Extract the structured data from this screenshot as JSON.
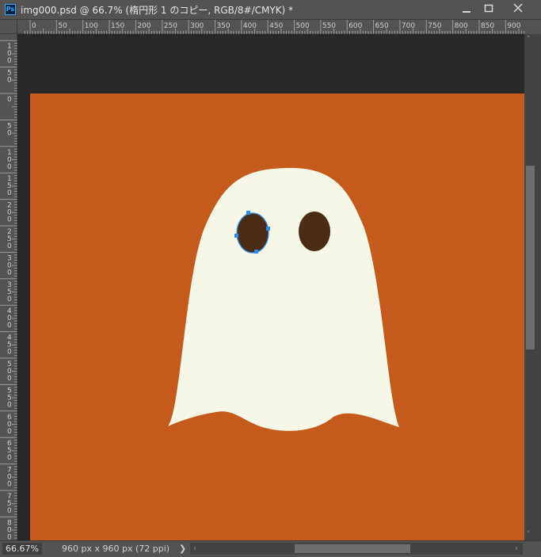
{
  "window": {
    "app_icon": "ps-app-icon",
    "app_icon_text": "Ps",
    "title": "img000.psd @ 66.7% (楕円形 1 のコピー, RGB/8#/CMYK) *",
    "controls": [
      "minimize-icon",
      "maximize-icon",
      "close-icon"
    ]
  },
  "rulers": {
    "horizontal_labels": [
      "0",
      "50",
      "100",
      "150",
      "200",
      "250",
      "300",
      "350",
      "400",
      "450",
      "500",
      "550",
      "600",
      "650",
      "700",
      "750",
      "800",
      "850",
      "900"
    ],
    "vertical_labels": [
      "100",
      "50",
      "0",
      "50",
      "100",
      "150",
      "200",
      "250",
      "300",
      "350",
      "400",
      "450",
      "500",
      "550",
      "600",
      "650",
      "700",
      "750",
      "800"
    ]
  },
  "canvas": {
    "background_color": "#c45b1d",
    "pasteboard_color": "#282828",
    "ghost_color": "#f7f7e7",
    "eye_color": "#4a2c14",
    "selection_color": "#2f8ce6",
    "selected_layer": "楕円形 1 のコピー"
  },
  "status": {
    "zoom": "66.67%",
    "doc_info": "960 px x 960 px (72 ppi)",
    "arrow": "❯"
  },
  "scrollbars": {
    "h_left": "‹",
    "h_right": "›",
    "v_up": "˄",
    "v_down": "˅"
  }
}
